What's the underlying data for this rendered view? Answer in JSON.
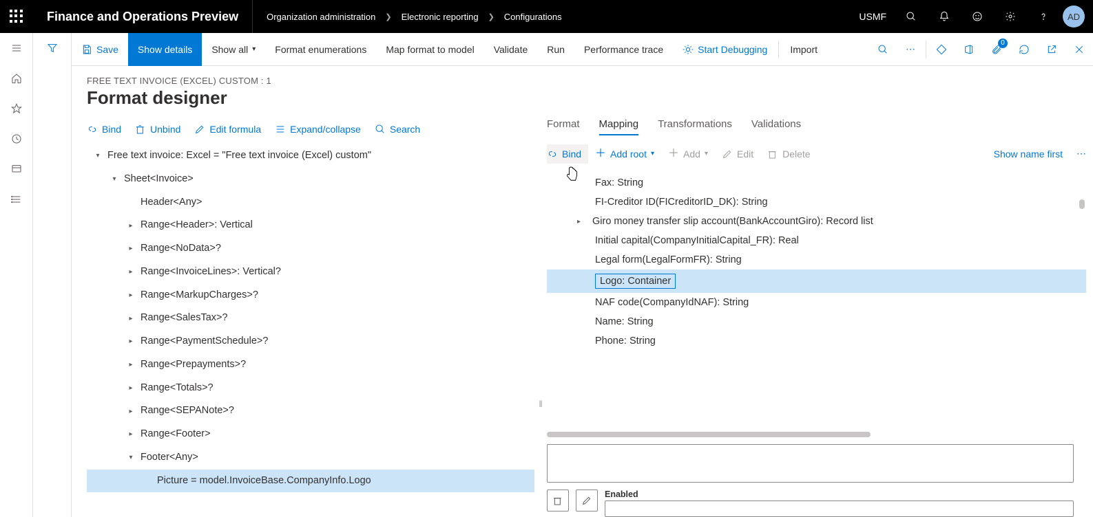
{
  "topbar": {
    "app_title": "Finance and Operations Preview",
    "breadcrumb": [
      "Organization administration",
      "Electronic reporting",
      "Configurations"
    ],
    "company": "USMF",
    "avatar": "AD"
  },
  "action_bar": {
    "save": "Save",
    "show_details": "Show details",
    "show_all": "Show all",
    "format_enum": "Format enumerations",
    "map_format": "Map format to model",
    "validate": "Validate",
    "run": "Run",
    "perf_trace": "Performance trace",
    "start_debug": "Start Debugging",
    "import": "Import",
    "badge": "0"
  },
  "page": {
    "path": "FREE TEXT INVOICE (EXCEL) CUSTOM : 1",
    "title": "Format designer"
  },
  "left_toolbar": {
    "bind": "Bind",
    "unbind": "Unbind",
    "edit_formula": "Edit formula",
    "expand": "Expand/collapse",
    "search": "Search"
  },
  "tree": [
    {
      "indent": 0,
      "caret": "down",
      "label": "Free text invoice: Excel = \"Free text invoice (Excel) custom\""
    },
    {
      "indent": 1,
      "caret": "down",
      "label": "Sheet<Invoice>"
    },
    {
      "indent": 2,
      "caret": "",
      "label": "Header<Any>"
    },
    {
      "indent": 2,
      "caret": "right",
      "label": "Range<Header>: Vertical"
    },
    {
      "indent": 2,
      "caret": "right",
      "label": "Range<NoData>?"
    },
    {
      "indent": 2,
      "caret": "right",
      "label": "Range<InvoiceLines>: Vertical?"
    },
    {
      "indent": 2,
      "caret": "right",
      "label": "Range<MarkupCharges>?"
    },
    {
      "indent": 2,
      "caret": "right",
      "label": "Range<SalesTax>?"
    },
    {
      "indent": 2,
      "caret": "right",
      "label": "Range<PaymentSchedule>?"
    },
    {
      "indent": 2,
      "caret": "right",
      "label": "Range<Prepayments>?"
    },
    {
      "indent": 2,
      "caret": "right",
      "label": "Range<Totals>?"
    },
    {
      "indent": 2,
      "caret": "right",
      "label": "Range<SEPANote>?"
    },
    {
      "indent": 2,
      "caret": "right",
      "label": "Range<Footer>"
    },
    {
      "indent": 2,
      "caret": "down",
      "label": "Footer<Any>"
    },
    {
      "indent": 3,
      "caret": "",
      "label": "Picture = model.InvoiceBase.CompanyInfo.Logo",
      "selected": true
    }
  ],
  "tabs": {
    "format": "Format",
    "mapping": "Mapping",
    "transformations": "Transformations",
    "validations": "Validations"
  },
  "right_toolbar": {
    "bind": "Bind",
    "add_root": "Add root",
    "add": "Add",
    "edit": "Edit",
    "delete": "Delete",
    "show_name_first": "Show name first"
  },
  "mapping": [
    {
      "label": "Fax: String"
    },
    {
      "label": "FI-Creditor ID(FICreditorID_DK): String"
    },
    {
      "label": "Giro money transfer slip account(BankAccountGiro): Record list",
      "caret": "right"
    },
    {
      "label": "Initial capital(CompanyInitialCapital_FR): Real"
    },
    {
      "label": "Legal form(LegalFormFR): String"
    },
    {
      "label": "Logo: Container",
      "selected": true
    },
    {
      "label": "NAF code(CompanyIdNAF): String"
    },
    {
      "label": "Name: String"
    },
    {
      "label": "Phone: String"
    }
  ],
  "enabled_label": "Enabled"
}
